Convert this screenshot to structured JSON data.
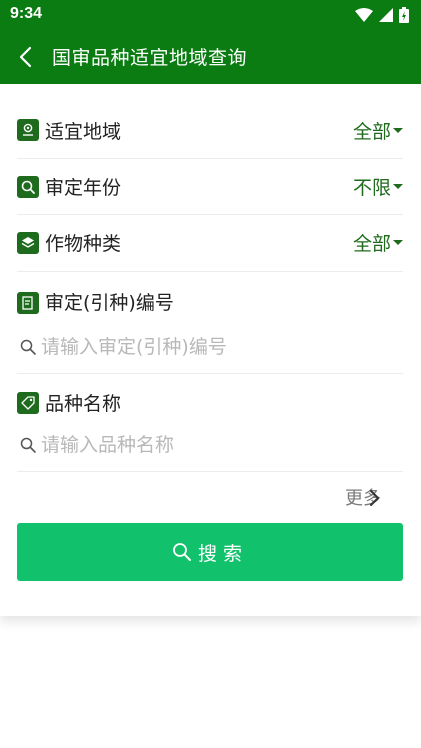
{
  "status_bar": {
    "time": "9:34",
    "icons": [
      "wifi-icon",
      "cell-signal-icon",
      "battery-charging-icon"
    ]
  },
  "app_bar": {
    "title": "国审品种适宜地域查询",
    "back_icon": "chevron-left-icon"
  },
  "filters": {
    "region": {
      "label": "适宜地域",
      "value": "全部",
      "icon": "location-icon"
    },
    "year": {
      "label": "审定年份",
      "value": "不限",
      "icon": "search-box-icon"
    },
    "crop": {
      "label": "作物种类",
      "value": "全部",
      "icon": "layers-icon"
    }
  },
  "approval_number": {
    "label": "审定(引种)编号",
    "placeholder": "请输入审定(引种)编号",
    "value": "",
    "icon": "document-icon"
  },
  "variety_name": {
    "label": "品种名称",
    "placeholder": "请输入品种名称",
    "value": "",
    "icon": "tag-icon"
  },
  "more": {
    "label": "更多"
  },
  "search_button": {
    "label": "搜索"
  },
  "colors": {
    "primary": "#0b7c12",
    "accent": "#12c16c",
    "icon_bg": "#1f6b1d",
    "divider": "#ececec",
    "placeholder": "#b8b8b8"
  }
}
